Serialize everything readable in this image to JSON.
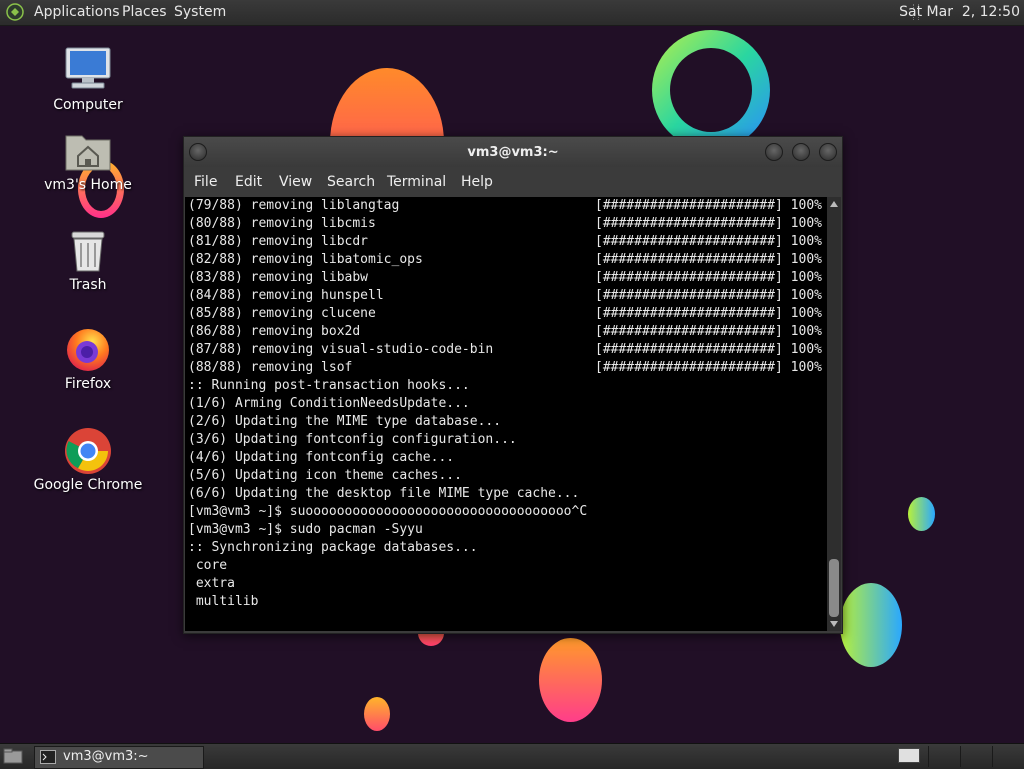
{
  "top_panel": {
    "menus": [
      "Applications",
      "Places",
      "System"
    ],
    "clock": "Sat Mar  2, 12:50"
  },
  "desktop_icons": [
    {
      "label": "Computer",
      "icon": "computer-icon"
    },
    {
      "label": "vm3's Home",
      "icon": "home-folder-icon"
    },
    {
      "label": "Trash",
      "icon": "trash-icon"
    },
    {
      "label": "Firefox",
      "icon": "firefox-icon"
    },
    {
      "label": "Google Chrome",
      "icon": "chrome-icon"
    }
  ],
  "window": {
    "title": "vm3@vm3:~",
    "menus": [
      "File",
      "Edit",
      "View",
      "Search",
      "Terminal",
      "Help"
    ]
  },
  "terminal": {
    "progress_lines": [
      {
        "text": "(79/88) removing liblangtag",
        "bar": "[######################] 100%"
      },
      {
        "text": "(80/88) removing libcmis",
        "bar": "[######################] 100%"
      },
      {
        "text": "(81/88) removing libcdr",
        "bar": "[######################] 100%"
      },
      {
        "text": "(82/88) removing libatomic_ops",
        "bar": "[######################] 100%"
      },
      {
        "text": "(83/88) removing libabw",
        "bar": "[######################] 100%"
      },
      {
        "text": "(84/88) removing hunspell",
        "bar": "[######################] 100%"
      },
      {
        "text": "(85/88) removing clucene",
        "bar": "[######################] 100%"
      },
      {
        "text": "(86/88) removing box2d",
        "bar": "[######################] 100%"
      },
      {
        "text": "(87/88) removing visual-studio-code-bin",
        "bar": "[######################] 100%"
      },
      {
        "text": "(88/88) removing lsof",
        "bar": "[######################] 100%"
      }
    ],
    "lines": [
      ":: Running post-transaction hooks...",
      "(1/6) Arming ConditionNeedsUpdate...",
      "(2/6) Updating the MIME type database...",
      "(3/6) Updating fontconfig configuration...",
      "(4/6) Updating fontconfig cache...",
      "(5/6) Updating icon theme caches...",
      "(6/6) Updating the desktop file MIME type cache...",
      "[vm3@vm3 ~]$ suoooooooooooooooooooooooooooooooooo^C",
      "[vm3@vm3 ~]$ sudo pacman -Syyu",
      ":: Synchronizing package databases...",
      " core",
      " extra",
      " multilib"
    ]
  },
  "taskbar": {
    "task_label": "vm3@vm3:~"
  }
}
